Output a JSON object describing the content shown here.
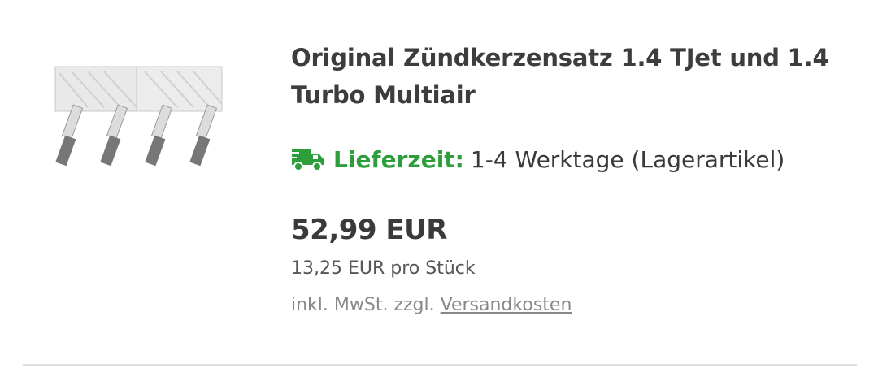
{
  "product": {
    "image_alt": "spark-plugs-set-image",
    "title": "Original Zündkerzensatz 1.4 TJet und 1.4 Turbo Multiair",
    "delivery": {
      "icon": "truck-icon",
      "label": "Lieferzeit:",
      "value": "1-4 Werktage (Lagerartikel)",
      "color": "#2e9e3d"
    },
    "price": "52,99 EUR",
    "unit_price": "13,25 EUR pro Stück",
    "tax_prefix": "inkl. MwSt. zzgl.",
    "shipping_link": "Versandkosten"
  }
}
